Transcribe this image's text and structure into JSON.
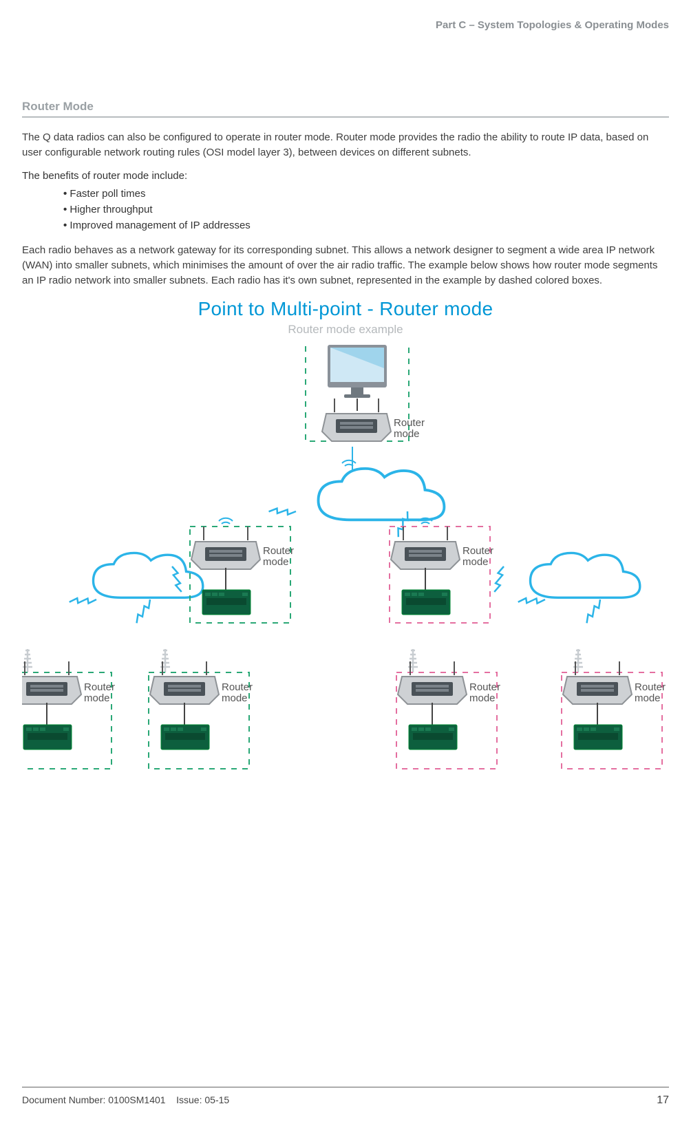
{
  "header": {
    "part": "Part C – System Topologies & Operating Modes"
  },
  "section": {
    "title": "Router Mode"
  },
  "body": {
    "para1": "The Q data radios can also be configured to operate in router mode. Router mode provides the radio the ability to route IP data, based on user configurable network routing rules (OSI model layer 3), between devices on different subnets.",
    "benefits_intro": "The benefits of router mode include:",
    "bullets": [
      "Faster poll times",
      "Higher throughput",
      "Improved management of IP addresses"
    ],
    "para2": "Each radio behaves as a network gateway for its corresponding subnet. This allows a network designer to segment a wide area IP network (WAN) into smaller subnets, which minimises the amount of over the air radio traffic. The example below shows how router mode segments an IP radio network into smaller subnets. Each radio has it's own subnet, represented in the example by dashed colored boxes."
  },
  "diagram": {
    "title": "Point to Multi-point - Router mode",
    "subtitle": "Router mode example",
    "node_label_line1": "Router",
    "node_label_line2": "mode"
  },
  "footer": {
    "doc": "Document Number: 0100SM1401",
    "issue": "Issue: 05-15",
    "page": "17"
  },
  "colors": {
    "accent": "#0097d6",
    "pink": "#e46fa0",
    "green": "#2aa876",
    "cloud_fill": "#ffffff",
    "cloud_stroke": "#2bb4e8",
    "device_body": "#d7d9db",
    "device_dark": "#4a5258",
    "board": "#0d5f3e",
    "monitor": "#2bb4e8"
  }
}
